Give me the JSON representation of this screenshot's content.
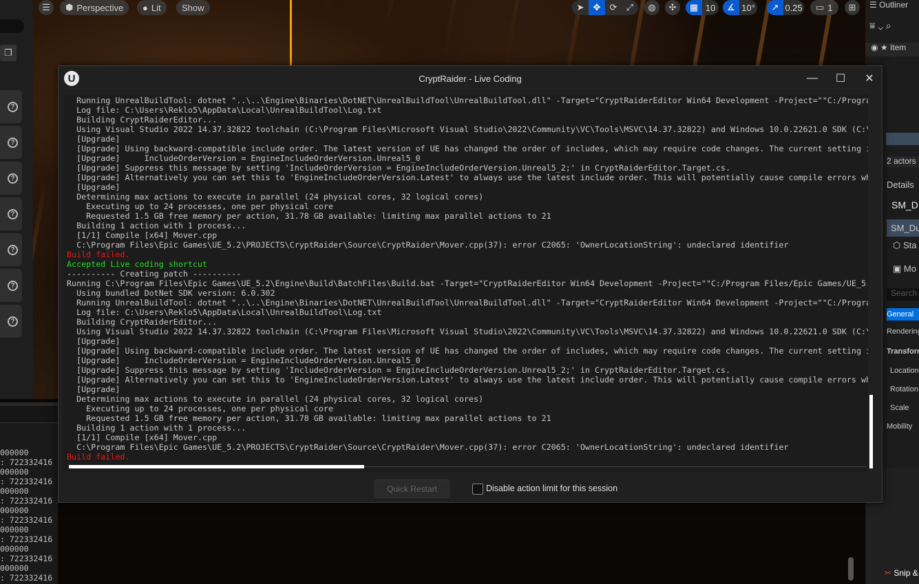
{
  "viewport_toolbar": {
    "menu_icon": "hamburger-icon",
    "perspective": "Perspective",
    "lit": "Lit",
    "show": "Show",
    "grid_snap": "10",
    "rotation_snap": "10°",
    "scale_snap": "0.25",
    "camera_speed": "1"
  },
  "left_output": {
    "lines": [
      "000000",
      ": 722332416",
      "000000",
      ": 722332416",
      "000000",
      ": 722332416",
      "000000",
      ": 722332416",
      "000000",
      ": 722332416",
      "000000",
      ": 722332416",
      "000000",
      ": 722332416"
    ]
  },
  "right_panel": {
    "outliner": "Outliner",
    "item_col": "Item",
    "actors": "2 actors",
    "details": "Details",
    "object_name": "SM_D",
    "component": "SM_Du",
    "static_mesh": "Sta",
    "mover": "Mo",
    "search_placeholder": "Search",
    "tabs": [
      "General",
      "Rendering"
    ],
    "transform": "Transform",
    "location": "Location",
    "rotation": "Rotation",
    "scale": "Scale",
    "mobility": "Mobility",
    "taskbar": "Snip &"
  },
  "window": {
    "title": "CryptRaider - Live Coding",
    "minimize": "—",
    "maximize": "☐",
    "close": "✕"
  },
  "colors": {
    "normal": "#c8c8c8",
    "error": "#f01616",
    "success": "#22e022"
  },
  "log": [
    {
      "t": "  Running UnrealBuildTool: dotnet \"..\\..\\Engine\\Binaries\\DotNET\\UnrealBuildTool\\UnrealBuildTool.dll\" -Target=\"CryptRaiderEditor Win64 Development -Project=\"\"C:/Progra",
      "c": "normal"
    },
    {
      "t": "  Log file: C:\\Users\\Reklo5\\AppData\\Local\\UnrealBuildTool\\Log.txt",
      "c": "normal"
    },
    {
      "t": "  Building CryptRaiderEditor...",
      "c": "normal"
    },
    {
      "t": "  Using Visual Studio 2022 14.37.32822 toolchain (C:\\Program Files\\Microsoft Visual Studio\\2022\\Community\\VC\\Tools\\MSVC\\14.37.32822) and Windows 10.0.22621.0 SDK (C:\\",
      "c": "normal"
    },
    {
      "t": "  [Upgrade]",
      "c": "normal"
    },
    {
      "t": "  [Upgrade] Using backward-compatible include order. The latest version of UE has changed the order of includes, which may require code changes. The current setting i",
      "c": "normal"
    },
    {
      "t": "  [Upgrade]     IncludeOrderVersion = EngineIncludeOrderVersion.Unreal5_0",
      "c": "normal"
    },
    {
      "t": "  [Upgrade] Suppress this message by setting 'IncludeOrderVersion = EngineIncludeOrderVersion.Unreal5_2;' in CryptRaiderEditor.Target.cs.",
      "c": "normal"
    },
    {
      "t": "  [Upgrade] Alternatively you can set this to 'EngineIncludeOrderVersion.Latest' to always use the latest include order. This will potentially cause compile errors wh",
      "c": "normal"
    },
    {
      "t": "  [Upgrade]",
      "c": "normal"
    },
    {
      "t": "  Determining max actions to execute in parallel (24 physical cores, 32 logical cores)",
      "c": "normal"
    },
    {
      "t": "    Executing up to 24 processes, one per physical core",
      "c": "normal"
    },
    {
      "t": "    Requested 1.5 GB free memory per action, 31.78 GB available: limiting max parallel actions to 21",
      "c": "normal"
    },
    {
      "t": "  Building 1 action with 1 process...",
      "c": "normal"
    },
    {
      "t": "  [1/1] Compile [x64] Mover.cpp",
      "c": "normal"
    },
    {
      "t": "  C:\\Program Files\\Epic Games\\UE_5.2\\PROJECTS\\CryptRaider\\Source\\CryptRaider\\Mover.cpp(37): error C2065: 'OwnerLocationString': undeclared identifier",
      "c": "normal"
    },
    {
      "t": "Build failed.",
      "c": "error"
    },
    {
      "t": "Accepted Live coding shortcut",
      "c": "success"
    },
    {
      "t": "---------- Creating patch ----------",
      "c": "normal"
    },
    {
      "t": "Running C:\\Program Files\\Epic Games\\UE_5.2\\Engine\\Build\\BatchFiles\\Build.bat -Target=\"CryptRaiderEditor Win64 Development -Project=\"\"C:/Program Files/Epic Games/UE_5.",
      "c": "normal"
    },
    {
      "t": "  Using bundled DotNet SDK version: 6.0.302",
      "c": "normal"
    },
    {
      "t": "  Running UnrealBuildTool: dotnet \"..\\..\\Engine\\Binaries\\DotNET\\UnrealBuildTool\\UnrealBuildTool.dll\" -Target=\"CryptRaiderEditor Win64 Development -Project=\"\"C:/Progra",
      "c": "normal"
    },
    {
      "t": "  Log file: C:\\Users\\Reklo5\\AppData\\Local\\UnrealBuildTool\\Log.txt",
      "c": "normal"
    },
    {
      "t": "  Building CryptRaiderEditor...",
      "c": "normal"
    },
    {
      "t": "  Using Visual Studio 2022 14.37.32822 toolchain (C:\\Program Files\\Microsoft Visual Studio\\2022\\Community\\VC\\Tools\\MSVC\\14.37.32822) and Windows 10.0.22621.0 SDK (C:\\",
      "c": "normal"
    },
    {
      "t": "  [Upgrade]",
      "c": "normal"
    },
    {
      "t": "  [Upgrade] Using backward-compatible include order. The latest version of UE has changed the order of includes, which may require code changes. The current setting i",
      "c": "normal"
    },
    {
      "t": "  [Upgrade]     IncludeOrderVersion = EngineIncludeOrderVersion.Unreal5_0",
      "c": "normal"
    },
    {
      "t": "  [Upgrade] Suppress this message by setting 'IncludeOrderVersion = EngineIncludeOrderVersion.Unreal5_2;' in CryptRaiderEditor.Target.cs.",
      "c": "normal"
    },
    {
      "t": "  [Upgrade] Alternatively you can set this to 'EngineIncludeOrderVersion.Latest' to always use the latest include order. This will potentially cause compile errors wh",
      "c": "normal"
    },
    {
      "t": "  [Upgrade]",
      "c": "normal"
    },
    {
      "t": "  Determining max actions to execute in parallel (24 physical cores, 32 logical cores)",
      "c": "normal"
    },
    {
      "t": "    Executing up to 24 processes, one per physical core",
      "c": "normal"
    },
    {
      "t": "    Requested 1.5 GB free memory per action, 31.78 GB available: limiting max parallel actions to 21",
      "c": "normal"
    },
    {
      "t": "  Building 1 action with 1 process...",
      "c": "normal"
    },
    {
      "t": "  [1/1] Compile [x64] Mover.cpp",
      "c": "normal"
    },
    {
      "t": "  C:\\Program Files\\Epic Games\\UE_5.2\\PROJECTS\\CryptRaider\\Source\\CryptRaider\\Mover.cpp(37): error C2065: 'OwnerLocationString': undeclared identifier",
      "c": "normal"
    },
    {
      "t": "Build failed.",
      "c": "error"
    }
  ],
  "footer": {
    "quick_restart": "Quick Restart",
    "disable_limit": "Disable action limit for this session",
    "disable_limit_checked": false
  }
}
